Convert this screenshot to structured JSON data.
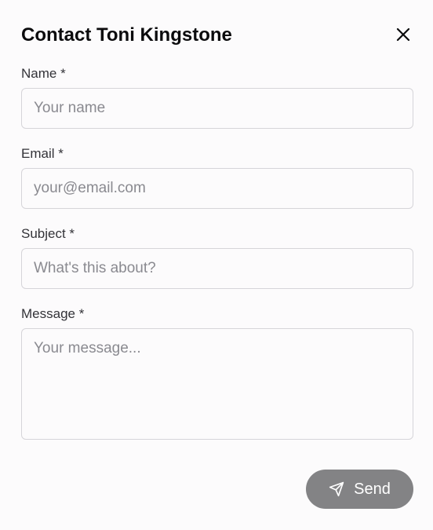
{
  "dialog": {
    "title": "Contact Toni Kingstone",
    "close_icon": "close-icon"
  },
  "form": {
    "name": {
      "label": "Name *",
      "placeholder": "Your name",
      "value": ""
    },
    "email": {
      "label": "Email *",
      "placeholder": "your@email.com",
      "value": ""
    },
    "subject": {
      "label": "Subject *",
      "placeholder": "What's this about?",
      "value": ""
    },
    "message": {
      "label": "Message *",
      "placeholder": "Your message...",
      "value": ""
    }
  },
  "actions": {
    "send_label": "Send",
    "send_icon": "send-icon"
  },
  "colors": {
    "background": "#fcfbfc",
    "title": "#0b0b0d",
    "label": "#333338",
    "border": "#d6d5d9",
    "placeholder": "#8a8a90",
    "send_button": "#838385",
    "send_text": "#ffffff"
  }
}
